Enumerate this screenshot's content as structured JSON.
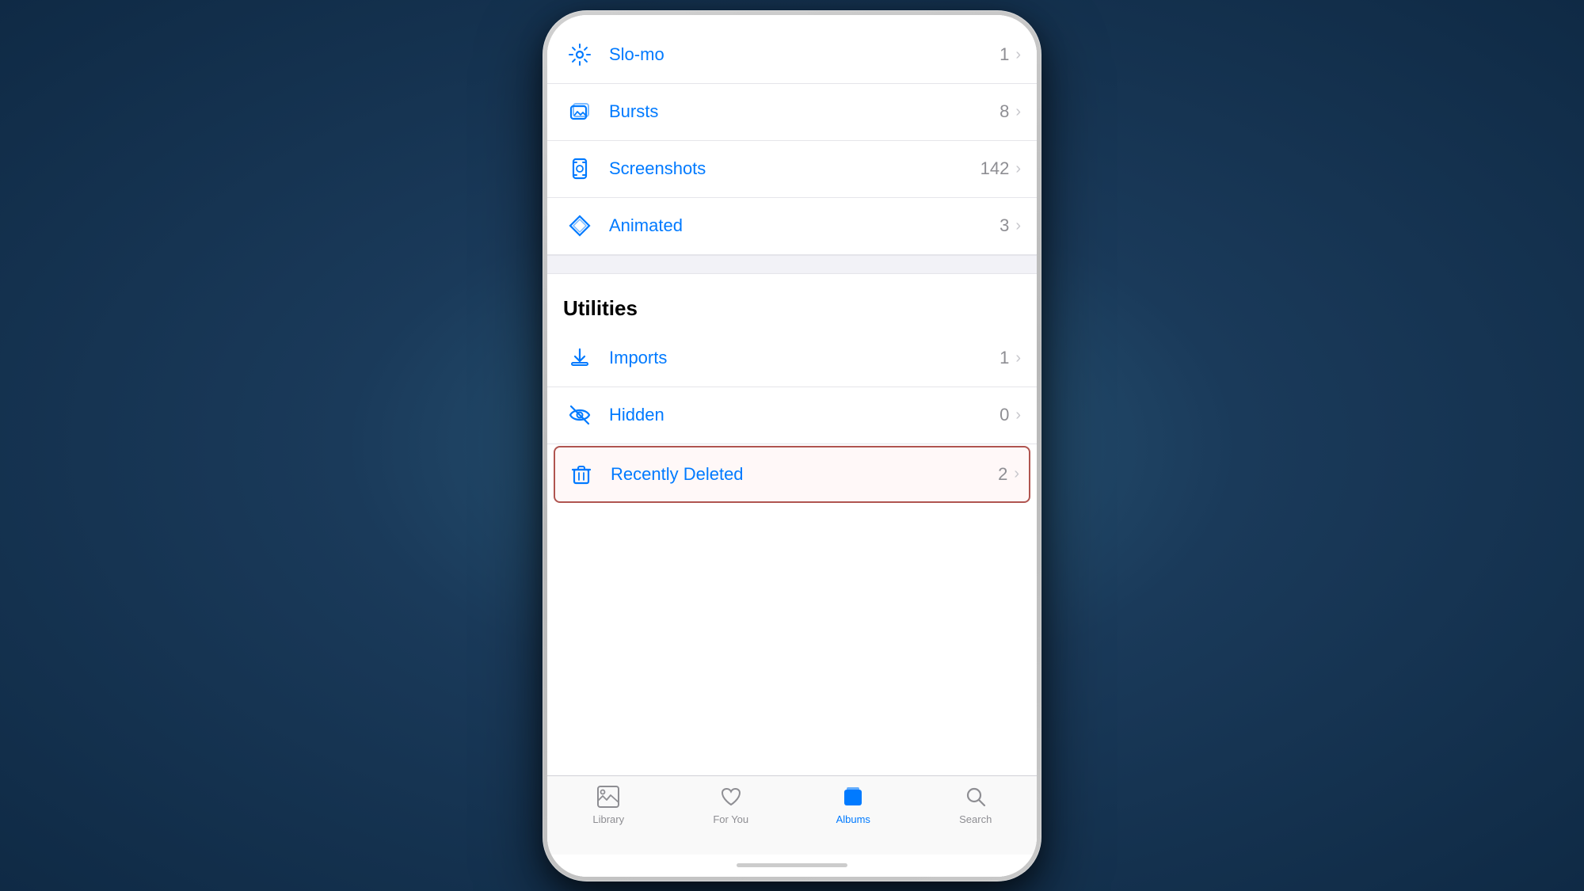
{
  "background": {
    "gradient_center": "#2a5a7a",
    "gradient_edge": "#0f2a45"
  },
  "phone": {
    "border_color": "#c8c8c8"
  },
  "list_items": [
    {
      "id": "slo-mo",
      "label": "Slo-mo",
      "count": "1",
      "icon": "slo-mo-icon",
      "highlighted": false
    },
    {
      "id": "bursts",
      "label": "Bursts",
      "count": "8",
      "icon": "bursts-icon",
      "highlighted": false
    },
    {
      "id": "screenshots",
      "label": "Screenshots",
      "count": "142",
      "icon": "screenshots-icon",
      "highlighted": false
    },
    {
      "id": "animated",
      "label": "Animated",
      "count": "3",
      "icon": "animated-icon",
      "highlighted": false
    }
  ],
  "utilities_section": {
    "header": "Utilities",
    "items": [
      {
        "id": "imports",
        "label": "Imports",
        "count": "1",
        "icon": "imports-icon",
        "highlighted": false
      },
      {
        "id": "hidden",
        "label": "Hidden",
        "count": "0",
        "icon": "hidden-icon",
        "highlighted": false
      },
      {
        "id": "recently-deleted",
        "label": "Recently Deleted",
        "count": "2",
        "icon": "trash-icon",
        "highlighted": true
      }
    ]
  },
  "tab_bar": {
    "items": [
      {
        "id": "library",
        "label": "Library",
        "active": false,
        "icon": "library-icon"
      },
      {
        "id": "for-you",
        "label": "For You",
        "active": false,
        "icon": "for-you-icon"
      },
      {
        "id": "albums",
        "label": "Albums",
        "active": true,
        "icon": "albums-icon"
      },
      {
        "id": "search",
        "label": "Search",
        "active": false,
        "icon": "search-icon"
      }
    ]
  }
}
